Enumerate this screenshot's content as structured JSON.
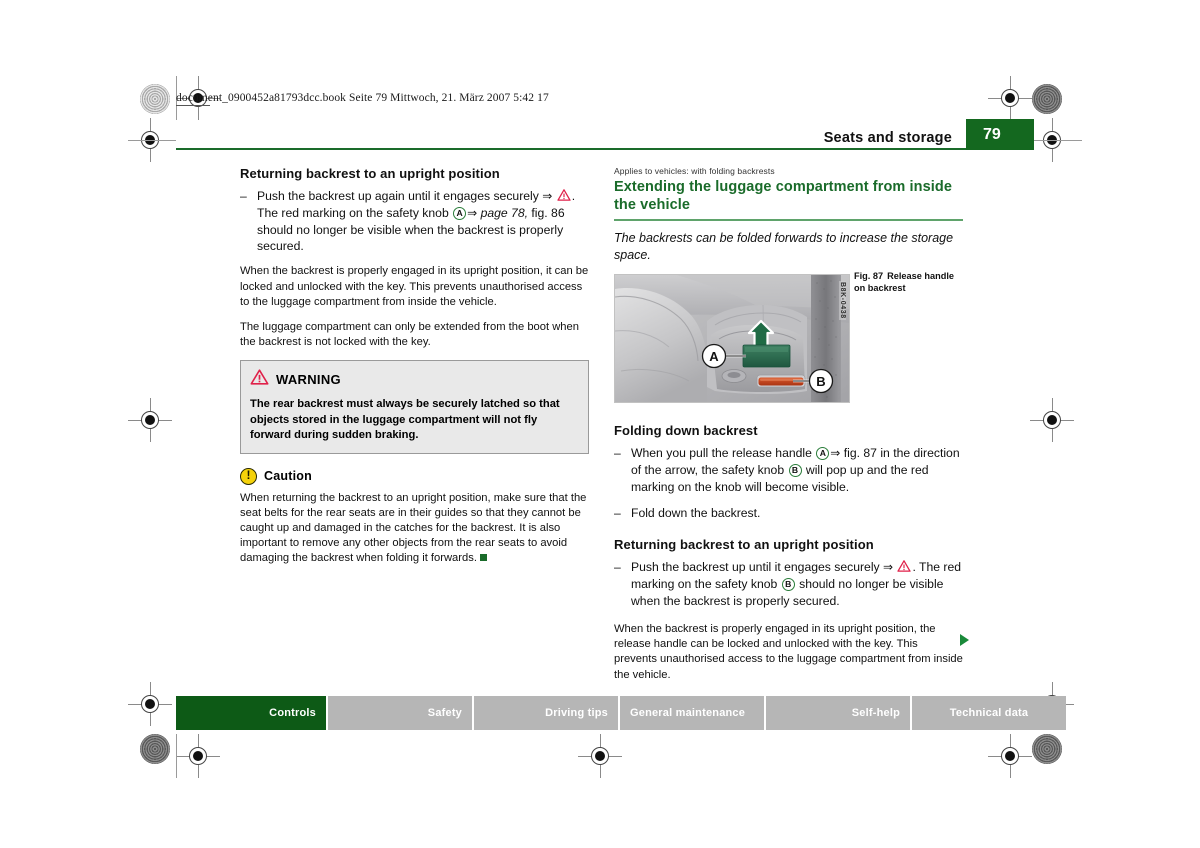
{
  "print_header": {
    "file_line": "document_0900452a81793dcc.book  Seite 79  Mittwoch, 21. März 2007  5:42 17"
  },
  "running_head": {
    "chapter_title": "Seats and storage",
    "page_number": "79",
    "accent_color": "#14681f"
  },
  "left_column": {
    "section_heading": "Returning backrest to an upright position",
    "bullet_1": {
      "dash": "–",
      "part_1": "Push the backrest up again until it engages securely ",
      "arrow_1": "⇒",
      "warning_icon": "warning-triangle-icon",
      "part_2": ". The red marking on the safety knob ",
      "marker_a": "A",
      "arrow_2": "⇒",
      "ref_italic": "page 78,",
      "part_3": " fig. 86 should no longer be visible when the backrest is properly secured."
    },
    "paragraph_1": "When the backrest is properly engaged in its upright position, it can be locked and unlocked with the key. This prevents unauthorised access to the luggage compartment from inside the vehicle.",
    "paragraph_2": "The luggage compartment can only be extended from the boot when the backrest is not locked with the key.",
    "warning_box": {
      "icon": "warning-triangle-icon",
      "title": "WARNING",
      "text": "The rear backrest must always be securely latched so that objects stored in the luggage compartment will not fly forward during sudden braking.",
      "background_color": "#e9e9e9",
      "border_color": "#9a9a9a"
    },
    "caution_box": {
      "icon": "caution-exclamation-icon",
      "title": "Caution",
      "text": "When returning the backrest to an upright position, make sure that the seat belts for the rear seats are in their guides so that they cannot be caught up and damaged in the catches for the backrest. It is also important to remove any other objects from the rear seats to avoid damaging the backrest when folding it forwards.",
      "end_marker": "green-square-end-marker"
    }
  },
  "right_column": {
    "applies_to": "Applies to vehicles: with folding backrests",
    "section_heading": "Extending the luggage compartment from inside the vehicle",
    "heading_color": "#1a6b2a",
    "intro_italic": "The backrests can be folded forwards to increase the storage space.",
    "figure": {
      "image_code": "B8K-0438",
      "caption_label": "Fig. 87",
      "caption_text": "Release handle on backrest",
      "callout_a": "A",
      "callout_b": "B",
      "handle_color": "#2d6b4f",
      "knob_color": "#c4421f",
      "arrow_color": "#1f6b45"
    },
    "folding_heading": "Folding down backrest",
    "folding_bullet_1": {
      "dash": "–",
      "part_1": "When you pull the release handle ",
      "marker_a": "A",
      "arrow": "⇒",
      "part_2": " fig. 87 in the direction of the arrow, the safety knob ",
      "marker_b": "B",
      "part_3": " will pop up and the red marking on the knob will become visible."
    },
    "folding_bullet_2": {
      "dash": "–",
      "text": "Fold down the backrest."
    },
    "returning_heading": "Returning backrest to an upright position",
    "returning_bullet": {
      "dash": "–",
      "part_1": "Push the backrest up until it engages securely ",
      "arrow": "⇒",
      "warning_icon": "warning-triangle-icon",
      "part_2": ". The red marking on the safety knob ",
      "marker_b": "B",
      "part_3": " should no longer be visible when the backrest is properly secured."
    },
    "closing_paragraph": "When the backrest is properly engaged in its upright position, the release handle can be locked and unlocked with the key. This prevents unauthorised access to the luggage compartment from inside the vehicle.",
    "continuation_marker": "continuation-arrow"
  },
  "footer_tabs": [
    {
      "label": "Controls",
      "active": true
    },
    {
      "label": "Safety",
      "active": false
    },
    {
      "label": "Driving tips",
      "active": false
    },
    {
      "label": "General maintenance",
      "active": false
    },
    {
      "label": "Self-help",
      "active": false
    },
    {
      "label": "Technical data",
      "active": false
    }
  ],
  "colors": {
    "brand_green": "#14681f",
    "rule_green": "#1a6b2a",
    "warning_red": "#e0214a",
    "caution_yellow": "#f5d20a",
    "tab_gray": "#b6b6b6"
  }
}
